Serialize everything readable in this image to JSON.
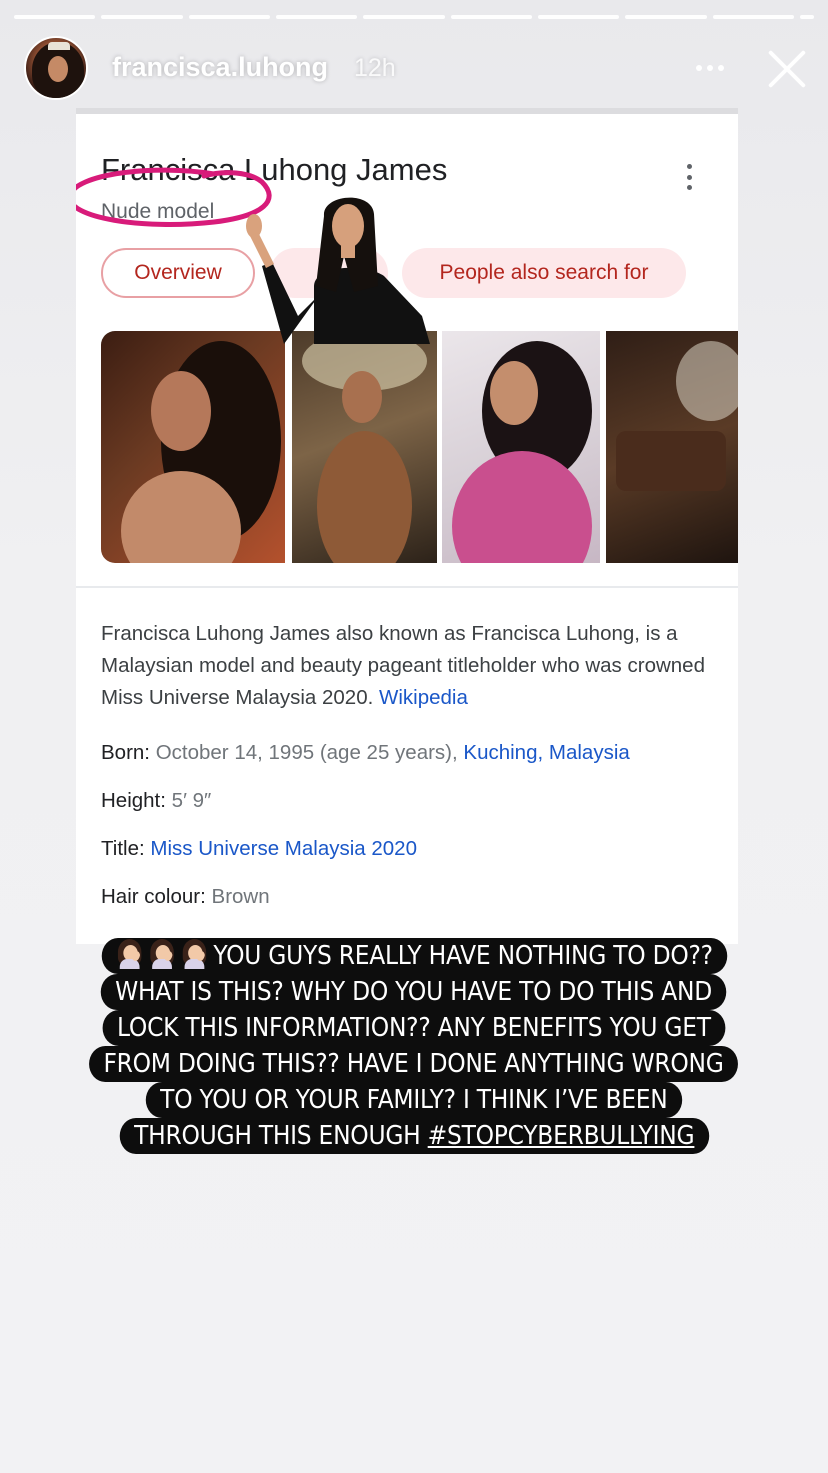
{
  "story": {
    "username": "francisca.luhong",
    "time_ago": "12h",
    "progress_segments": 10,
    "more_icon": "more-horizontal-icon",
    "close_icon": "close-icon"
  },
  "knowledge_panel": {
    "name": "Francisca Luhong James",
    "subtitle": "Nude model",
    "chips": [
      "Overview",
      "People also search for"
    ],
    "description": "Francisca Luhong James also known as Francisca Luhong, is a Malaysian model and beauty pageant titleholder who was crowned Miss Universe Malaysia 2020.",
    "description_link": "Wikipedia",
    "facts": {
      "born_label": "Born:",
      "born_value": "October 14, 1995 (age 25 years),",
      "born_link": "Kuching, Malaysia",
      "height_label": "Height:",
      "height_value": "5′ 9″",
      "title_label": "Title:",
      "title_link": "Miss Universe Malaysia 2020",
      "hair_label": "Hair colour:",
      "hair_value": "Brown"
    },
    "accent_color": "#b3261e",
    "link_color": "#1a57c8",
    "annotation_color": "#d81b7a"
  },
  "caption": {
    "line1": "YOU GUYS REALLY HAVE NOTHING TO DO??",
    "line2": "WHAT IS THIS? WHY DO YOU HAVE TO DO THIS AND",
    "line3": "LOCK THIS INFORMATION?? ANY BENEFITS YOU GET",
    "line4": "FROM DOING THIS?? HAVE I DONE ANYTHING WRONG",
    "line5": "TO YOU OR YOUR FAMILY? I THINK I’VE BEEN",
    "line6_text": "THROUGH THIS ENOUGH",
    "hashtag": "#STOPCYBERBULLYING",
    "emoji": "woman-facepalming-emoji"
  }
}
